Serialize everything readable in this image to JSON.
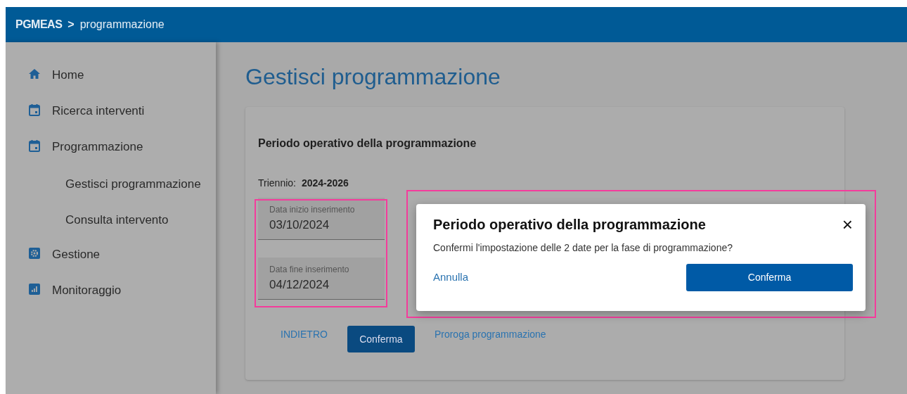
{
  "header": {
    "app": "PGMEAS",
    "separator": ">",
    "section": "programmazione"
  },
  "sidebar": {
    "items": [
      {
        "label": "Home",
        "kind": "home"
      },
      {
        "label": "Ricerca interventi",
        "kind": "calendar"
      },
      {
        "label": "Programmazione",
        "kind": "calendar",
        "children": [
          {
            "label": "Gestisci programmazione"
          },
          {
            "label": "Consulta intervento"
          }
        ]
      },
      {
        "label": "Gestione",
        "kind": "gear"
      },
      {
        "label": "Monitoraggio",
        "kind": "chart"
      }
    ]
  },
  "page_title": "Gestisci programmazione",
  "card": {
    "title": "Periodo operativo della programmazione",
    "triennio_label": "Triennio:",
    "triennio_value": "2024-2026",
    "fields_highlighted": true,
    "fields": [
      {
        "label": "Data inizio inserimento",
        "value": "03/10/2024"
      },
      {
        "label": "Data fine inserimento",
        "value": "04/12/2024"
      }
    ],
    "actions": [
      {
        "kind": "link",
        "label": "INDIETRO"
      },
      {
        "kind": "button",
        "label": "Conferma"
      },
      {
        "kind": "link",
        "label": "Proroga programmazione"
      }
    ]
  },
  "dialog": {
    "highlighted": true,
    "title": "Periodo operativo della programmazione",
    "close": "×",
    "message": "Confermi l'impostazione delle 2 date per la fase di programmazione?",
    "cancel": "Annulla",
    "confirm": "Conferma"
  }
}
